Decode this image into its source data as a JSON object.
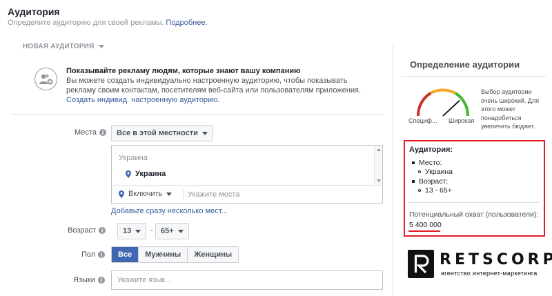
{
  "header": {
    "title": "Аудитория",
    "subtitle": "Определите аудиторию для своей рекламы.",
    "more_link": "Подробнее."
  },
  "new_audience_dropdown": "НОВАЯ АУДИТОРИЯ",
  "custom_audience": {
    "title": "Показывайте рекламу людям, которые знают вашу компанию",
    "line1": "Вы можете создать индивидуально настроенную аудиторию, чтобы показывать",
    "line2": "рекламу своим контактам, посетителям веб-сайта или пользователям приложения.",
    "link": "Создать индивид. настроенную аудиторию."
  },
  "form": {
    "places_label": "Места",
    "places_select": "Все в этой местности",
    "location_country": "Украина",
    "location_item": "Украина",
    "include_select": "Включить",
    "location_placeholder": "Укажите места",
    "multi_link": "Добавьте сразу несколько мест...",
    "age_label": "Возраст",
    "age_from": "13",
    "age_dash": "-",
    "age_to": "65+",
    "gender_label": "Пол",
    "gender_options": [
      "Все",
      "Мужчины",
      "Женщины"
    ],
    "gender_selected": "Все",
    "languages_label": "Языки",
    "languages_placeholder": "Укажите язык..."
  },
  "definition": {
    "title": "Определение аудитории",
    "gauge_specific": "Специф...",
    "gauge_broad": "Широкая",
    "gauge_level": 0.8,
    "gauge_text": "Выбор аудитории очень широкий. Для этого может понадобиться увеличить бюджет.",
    "colors": {
      "low": "#c9302c",
      "mid": "#f5a623",
      "high": "#42b72a"
    }
  },
  "summary": {
    "title": "Аудитория:",
    "place_label": "Место:",
    "place_value": "Украина",
    "age_label": "Возраст:",
    "age_value": "13 - 65+",
    "reach_label": "Потенциальный охват (пользователи):",
    "reach_value": "5 400 000",
    "highlight_color": "#e21d27"
  },
  "logo": {
    "name": "RETSCORP",
    "tagline": "агентство интернет-маркетинга"
  },
  "icons": [
    "info-icon",
    "caret-down-icon",
    "add-user-icon",
    "map-pin-icon",
    "gauge-icon"
  ]
}
